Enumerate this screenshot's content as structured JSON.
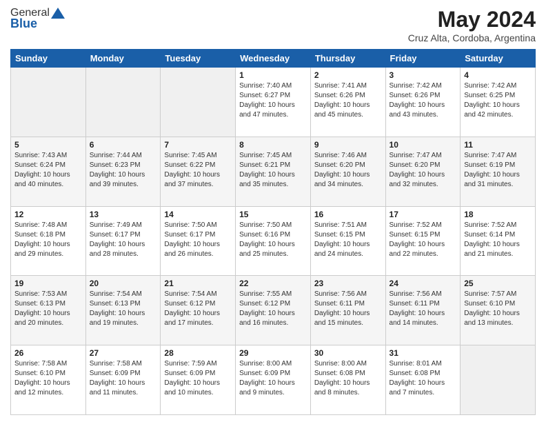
{
  "header": {
    "logo_general": "General",
    "logo_blue": "Blue",
    "month_year": "May 2024",
    "location": "Cruz Alta, Cordoba, Argentina"
  },
  "days_of_week": [
    "Sunday",
    "Monday",
    "Tuesday",
    "Wednesday",
    "Thursday",
    "Friday",
    "Saturday"
  ],
  "weeks": [
    [
      {
        "day": "",
        "info": ""
      },
      {
        "day": "",
        "info": ""
      },
      {
        "day": "",
        "info": ""
      },
      {
        "day": "1",
        "info": "Sunrise: 7:40 AM\nSunset: 6:27 PM\nDaylight: 10 hours\nand 47 minutes."
      },
      {
        "day": "2",
        "info": "Sunrise: 7:41 AM\nSunset: 6:26 PM\nDaylight: 10 hours\nand 45 minutes."
      },
      {
        "day": "3",
        "info": "Sunrise: 7:42 AM\nSunset: 6:26 PM\nDaylight: 10 hours\nand 43 minutes."
      },
      {
        "day": "4",
        "info": "Sunrise: 7:42 AM\nSunset: 6:25 PM\nDaylight: 10 hours\nand 42 minutes."
      }
    ],
    [
      {
        "day": "5",
        "info": "Sunrise: 7:43 AM\nSunset: 6:24 PM\nDaylight: 10 hours\nand 40 minutes."
      },
      {
        "day": "6",
        "info": "Sunrise: 7:44 AM\nSunset: 6:23 PM\nDaylight: 10 hours\nand 39 minutes."
      },
      {
        "day": "7",
        "info": "Sunrise: 7:45 AM\nSunset: 6:22 PM\nDaylight: 10 hours\nand 37 minutes."
      },
      {
        "day": "8",
        "info": "Sunrise: 7:45 AM\nSunset: 6:21 PM\nDaylight: 10 hours\nand 35 minutes."
      },
      {
        "day": "9",
        "info": "Sunrise: 7:46 AM\nSunset: 6:20 PM\nDaylight: 10 hours\nand 34 minutes."
      },
      {
        "day": "10",
        "info": "Sunrise: 7:47 AM\nSunset: 6:20 PM\nDaylight: 10 hours\nand 32 minutes."
      },
      {
        "day": "11",
        "info": "Sunrise: 7:47 AM\nSunset: 6:19 PM\nDaylight: 10 hours\nand 31 minutes."
      }
    ],
    [
      {
        "day": "12",
        "info": "Sunrise: 7:48 AM\nSunset: 6:18 PM\nDaylight: 10 hours\nand 29 minutes."
      },
      {
        "day": "13",
        "info": "Sunrise: 7:49 AM\nSunset: 6:17 PM\nDaylight: 10 hours\nand 28 minutes."
      },
      {
        "day": "14",
        "info": "Sunrise: 7:50 AM\nSunset: 6:17 PM\nDaylight: 10 hours\nand 26 minutes."
      },
      {
        "day": "15",
        "info": "Sunrise: 7:50 AM\nSunset: 6:16 PM\nDaylight: 10 hours\nand 25 minutes."
      },
      {
        "day": "16",
        "info": "Sunrise: 7:51 AM\nSunset: 6:15 PM\nDaylight: 10 hours\nand 24 minutes."
      },
      {
        "day": "17",
        "info": "Sunrise: 7:52 AM\nSunset: 6:15 PM\nDaylight: 10 hours\nand 22 minutes."
      },
      {
        "day": "18",
        "info": "Sunrise: 7:52 AM\nSunset: 6:14 PM\nDaylight: 10 hours\nand 21 minutes."
      }
    ],
    [
      {
        "day": "19",
        "info": "Sunrise: 7:53 AM\nSunset: 6:13 PM\nDaylight: 10 hours\nand 20 minutes."
      },
      {
        "day": "20",
        "info": "Sunrise: 7:54 AM\nSunset: 6:13 PM\nDaylight: 10 hours\nand 19 minutes."
      },
      {
        "day": "21",
        "info": "Sunrise: 7:54 AM\nSunset: 6:12 PM\nDaylight: 10 hours\nand 17 minutes."
      },
      {
        "day": "22",
        "info": "Sunrise: 7:55 AM\nSunset: 6:12 PM\nDaylight: 10 hours\nand 16 minutes."
      },
      {
        "day": "23",
        "info": "Sunrise: 7:56 AM\nSunset: 6:11 PM\nDaylight: 10 hours\nand 15 minutes."
      },
      {
        "day": "24",
        "info": "Sunrise: 7:56 AM\nSunset: 6:11 PM\nDaylight: 10 hours\nand 14 minutes."
      },
      {
        "day": "25",
        "info": "Sunrise: 7:57 AM\nSunset: 6:10 PM\nDaylight: 10 hours\nand 13 minutes."
      }
    ],
    [
      {
        "day": "26",
        "info": "Sunrise: 7:58 AM\nSunset: 6:10 PM\nDaylight: 10 hours\nand 12 minutes."
      },
      {
        "day": "27",
        "info": "Sunrise: 7:58 AM\nSunset: 6:09 PM\nDaylight: 10 hours\nand 11 minutes."
      },
      {
        "day": "28",
        "info": "Sunrise: 7:59 AM\nSunset: 6:09 PM\nDaylight: 10 hours\nand 10 minutes."
      },
      {
        "day": "29",
        "info": "Sunrise: 8:00 AM\nSunset: 6:09 PM\nDaylight: 10 hours\nand 9 minutes."
      },
      {
        "day": "30",
        "info": "Sunrise: 8:00 AM\nSunset: 6:08 PM\nDaylight: 10 hours\nand 8 minutes."
      },
      {
        "day": "31",
        "info": "Sunrise: 8:01 AM\nSunset: 6:08 PM\nDaylight: 10 hours\nand 7 minutes."
      },
      {
        "day": "",
        "info": ""
      }
    ]
  ]
}
